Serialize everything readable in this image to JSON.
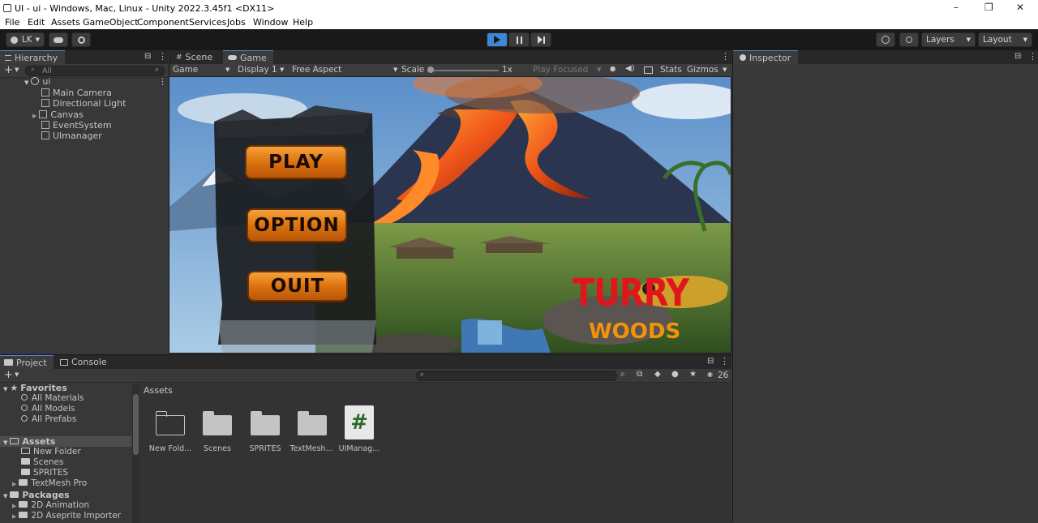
{
  "window": {
    "title": "UI - ui - Windows, Mac, Linux - Unity 2022.3.45f1 <DX11>",
    "minimize": "–",
    "maximize": "❐",
    "close": "✕"
  },
  "menu": [
    "File",
    "Edit",
    "Assets",
    "GameObject",
    "Component",
    "Services",
    "Jobs",
    "Window",
    "Help"
  ],
  "toolbar": {
    "account": "LK",
    "layers": "Layers",
    "layout": "Layout"
  },
  "hierarchy": {
    "tab": "Hierarchy",
    "search_placeholder": "All",
    "root": "ui",
    "items": [
      "Main Camera",
      "Directional Light",
      "Canvas",
      "EventSystem",
      "UImanager"
    ]
  },
  "view_tabs": {
    "scene": "Scene",
    "game": "Game"
  },
  "game_bar": {
    "mode": "Game",
    "display": "Display 1",
    "aspect": "Free Aspect",
    "scale_label": "Scale",
    "scale_value": "1x",
    "play_focused": "Play Focused",
    "stats": "Stats",
    "gizmos": "Gizmos"
  },
  "game_menu": {
    "play": "PLAY",
    "option": "OPTION",
    "quit": "OUIT",
    "logo_line1": "TURRY",
    "logo_line2": "WOODS"
  },
  "inspector": {
    "tab": "Inspector"
  },
  "project": {
    "tabs": [
      "Project",
      "Console"
    ],
    "favorites_label": "Favorites",
    "favorites": [
      "All Materials",
      "All Models",
      "All Prefabs"
    ],
    "assets_label": "Assets",
    "assets": [
      "New Folder",
      "Scenes",
      "SPRITES",
      "TextMesh Pro"
    ],
    "packages_label": "Packages",
    "packages": [
      "2D Animation",
      "2D Aseprite Importer"
    ],
    "breadcrumb": "Assets",
    "hidden_count": "26",
    "grid": [
      "New Fold...",
      "Scenes",
      "SPRITES",
      "TextMesh...",
      "UIManag..."
    ],
    "script_glyph": "#"
  },
  "colors": {
    "accent": "#3d87d5",
    "panel": "#383838",
    "dark": "#191919"
  }
}
